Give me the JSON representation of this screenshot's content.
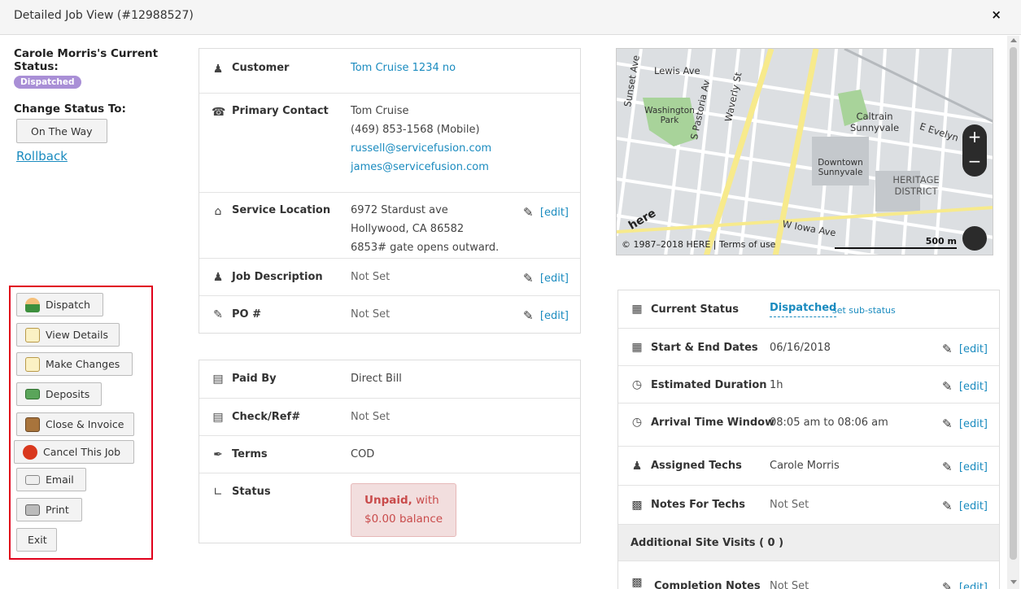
{
  "window": {
    "title": "Detailed Job View (#12988527)",
    "close": "×"
  },
  "left": {
    "status_heading": "Carole Morris's Current Status:",
    "status_badge": "Dispatched",
    "change_status_label": "Change Status To:",
    "change_status_button": "On The Way",
    "rollback_link": "Rollback"
  },
  "actions": [
    {
      "label": "Dispatch",
      "icon": "user-icon"
    },
    {
      "label": "View Details",
      "icon": "notepad-icon"
    },
    {
      "label": "Make Changes",
      "icon": "notepad-edit-icon"
    },
    {
      "label": "Deposits",
      "icon": "money-icon"
    },
    {
      "label": "Close & Invoice",
      "icon": "door-icon"
    },
    {
      "label": "Cancel This Job",
      "icon": "stop-icon"
    },
    {
      "label": "Email",
      "icon": "envelope-icon"
    },
    {
      "label": "Print",
      "icon": "printer-icon"
    },
    {
      "label": "Exit",
      "icon": ""
    }
  ],
  "job_panel": {
    "customer_label": "Customer",
    "customer_value": "Tom Cruise 1234 no",
    "contact_label": "Primary Contact",
    "contact_name": "Tom Cruise",
    "contact_phone": "(469) 853-1568 (Mobile)",
    "contact_email_1": "russell@servicefusion.com",
    "contact_email_2": "james@servicefusion.com",
    "location_label": "Service Location",
    "location_line1": "6972 Stardust ave",
    "location_line2": "Hollywood, CA 86582",
    "location_line3": "6853# gate opens outward.",
    "description_label": "Job Description",
    "description_value": "Not Set",
    "po_label": "PO #",
    "po_value": "Not Set",
    "edit": "[edit]"
  },
  "payment_panel": {
    "paid_by_label": "Paid By",
    "paid_by_value": "Direct Bill",
    "check_label": "Check/Ref#",
    "check_value": "Not Set",
    "terms_label": "Terms",
    "terms_value": "COD",
    "status_label": "Status",
    "status_unpaid": "Unpaid,",
    "status_with": " with",
    "status_balance": "$0.00 balance"
  },
  "map": {
    "labels": [
      "Lewis Ave",
      "Washington Park",
      "S Pastoria Av",
      "Waverly St",
      "Caltrain Sunnyvale",
      "E Evelyn",
      "Downtown Sunnyvale",
      "HERITAGE DISTRICT",
      "W Iowa Ave",
      "Sunset Ave"
    ],
    "copyright": "© 1987–2018 HERE | Terms of use",
    "scale": "500 m",
    "zoom_in": "+",
    "zoom_out": "−",
    "brand": "here"
  },
  "status_panel": {
    "current_status_label": "Current Status",
    "current_status_value": "Dispatched",
    "set_sub_status": "set sub-status",
    "dates_label": "Start & End Dates",
    "dates_value": "06/16/2018",
    "duration_label": "Estimated Duration",
    "duration_value": "1h",
    "arrival_label": "Arrival Time Window",
    "arrival_value": "08:05 am to 08:06 am",
    "techs_label": "Assigned Techs",
    "techs_value": "Carole Morris",
    "notes_label": "Notes For Techs",
    "notes_value": "Not Set",
    "site_visits_label": "Additional Site Visits ( 0 )",
    "completion_label": "Completion Notes",
    "completion_value": "Not Set",
    "edit": "[edit]"
  },
  "colors": {
    "link": "#1a8bbf",
    "badge": "#a98fd6",
    "highlight_box": "#e0001b",
    "unpaid_bg": "#f2dede"
  }
}
